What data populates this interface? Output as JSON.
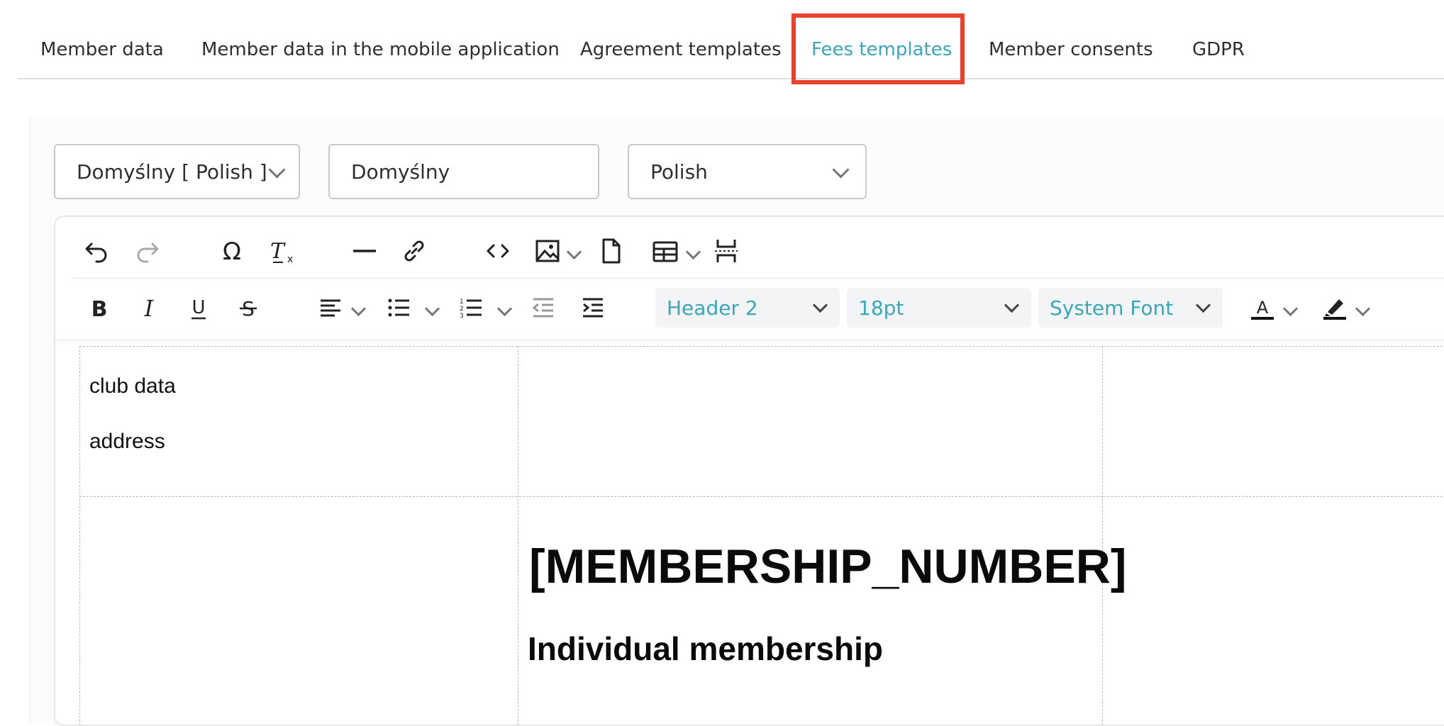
{
  "tabs": [
    {
      "label": "Member data",
      "active": false
    },
    {
      "label": "Member data in the mobile application",
      "active": false
    },
    {
      "label": "Agreement templates",
      "active": false
    },
    {
      "label": "Fees templates",
      "active": true
    },
    {
      "label": "Member consents",
      "active": false
    },
    {
      "label": "GDPR",
      "active": false
    }
  ],
  "filters": {
    "template_select": "Domyślny [ Polish ]",
    "template_name": "Domyślny",
    "language_select": "Polish"
  },
  "toolbar": {
    "row1": [
      "undo-icon",
      "redo-icon",
      "special-character-icon",
      "clear-formatting-icon",
      "horizontal-line-icon",
      "link-icon",
      "source-code-icon",
      "image-icon",
      "page-icon",
      "table-icon",
      "page-break-icon"
    ],
    "row2": [
      "bold-icon",
      "italic-icon",
      "underline-icon",
      "strikethrough-icon",
      "align-icon",
      "bullet-list-icon",
      "numbered-list-icon",
      "outdent-icon",
      "indent-icon",
      "text-color-icon",
      "highlight-icon"
    ],
    "block_format": "Header 2",
    "font_size": "18pt",
    "font_family": "System Font"
  },
  "document": {
    "club_data": "club data",
    "address": "address",
    "membership_number": "[MEMBERSHIP_NUMBER]",
    "membership_type": "Individual membership"
  },
  "colors": {
    "accent": "#3aa6b9",
    "highlight_border": "#e5432d"
  }
}
